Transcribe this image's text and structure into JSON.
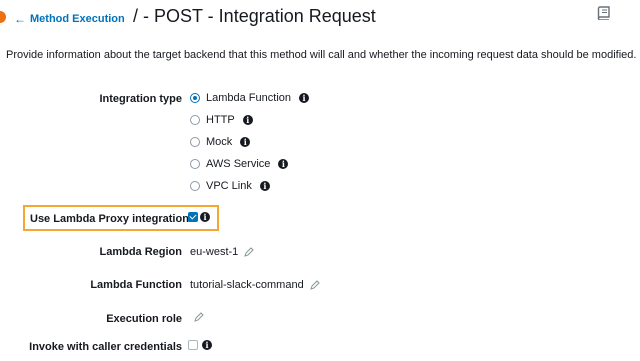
{
  "header": {
    "back_link": "Method Execution",
    "title": "/ - POST - Integration Request"
  },
  "description": "Provide information about the target backend that this method will call and whether the incoming request data should be modified.",
  "integration_type": {
    "label": "Integration type",
    "options": [
      {
        "label": "Lambda Function",
        "selected": true
      },
      {
        "label": "HTTP",
        "selected": false
      },
      {
        "label": "Mock",
        "selected": false
      },
      {
        "label": "AWS Service",
        "selected": false
      },
      {
        "label": "VPC Link",
        "selected": false
      }
    ]
  },
  "proxy": {
    "label": "Use Lambda Proxy integration",
    "checked": true
  },
  "lambda_region": {
    "label": "Lambda Region",
    "value": "eu-west-1"
  },
  "lambda_function": {
    "label": "Lambda Function",
    "value": "tutorial-slack-command"
  },
  "execution_role": {
    "label": "Execution role",
    "value": ""
  },
  "invoke_caller": {
    "label": "Invoke with caller credentials",
    "checked": false
  },
  "colors": {
    "link": "#0073bb",
    "highlight_border": "#f4a833",
    "accent": "#ec7211"
  }
}
